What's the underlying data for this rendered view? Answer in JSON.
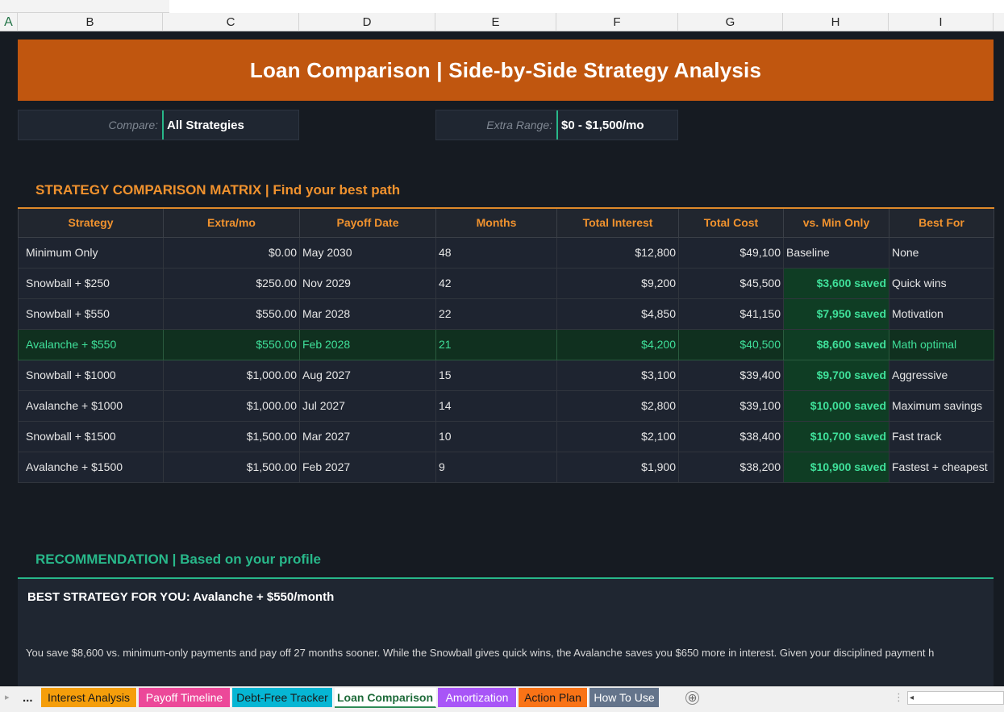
{
  "columns": [
    "A",
    "B",
    "C",
    "D",
    "E",
    "F",
    "G",
    "H",
    "I"
  ],
  "title": "Loan Comparison  |  Side-by-Side Strategy Analysis",
  "filters": {
    "compare_label": "Compare:",
    "compare_value": "All Strategies",
    "range_label": "Extra Range:",
    "range_value": "$0 - $1,500/mo"
  },
  "matrix": {
    "title": "STRATEGY COMPARISON MATRIX  |  Find your best path",
    "headers": [
      "Strategy",
      "Extra/mo",
      "Payoff Date",
      "Months",
      "Total Interest",
      "Total Cost",
      "vs. Min Only",
      "Best For"
    ],
    "rows": [
      [
        "Minimum Only",
        "$0.00",
        "May 2030",
        "48",
        "$12,800",
        "$49,100",
        "Baseline",
        "None"
      ],
      [
        "Snowball + $250",
        "$250.00",
        "Nov 2029",
        "42",
        "$9,200",
        "$45,500",
        "$3,600 saved",
        "Quick wins"
      ],
      [
        "Snowball + $550",
        "$550.00",
        "Mar 2028",
        "22",
        "$4,850",
        "$41,150",
        "$7,950 saved",
        "Motivation"
      ],
      [
        "Avalanche + $550",
        "$550.00",
        "Feb 2028",
        "21",
        "$4,200",
        "$40,500",
        "$8,600 saved",
        "Math optimal"
      ],
      [
        "Snowball + $1000",
        "$1,000.00",
        "Aug 2027",
        "15",
        "$3,100",
        "$39,400",
        "$9,700 saved",
        "Aggressive"
      ],
      [
        "Avalanche + $1000",
        "$1,000.00",
        "Jul 2027",
        "14",
        "$2,800",
        "$39,100",
        "$10,000 saved",
        "Maximum savings"
      ],
      [
        "Snowball + $1500",
        "$1,500.00",
        "Mar 2027",
        "10",
        "$2,100",
        "$38,400",
        "$10,700 saved",
        "Fast track"
      ],
      [
        "Avalanche + $1500",
        "$1,500.00",
        "Feb 2027",
        "9",
        "$1,900",
        "$38,200",
        "$10,900 saved",
        "Fastest + cheapest"
      ]
    ],
    "highlight_row": 3
  },
  "recommendation": {
    "title": "RECOMMENDATION  |  Based on your profile",
    "heading": "BEST STRATEGY FOR YOU: Avalanche + $550/month",
    "body": "You save $8,600 vs. minimum-only payments and pay off 27 months sooner. While the Snowball gives quick wins, the Avalanche saves you $650 more in interest. Given your disciplined payment h"
  },
  "tabs": {
    "ellipsis": "...",
    "items": [
      {
        "label": "Interest Analysis",
        "color": "#f59e0b"
      },
      {
        "label": "Payoff Timeline",
        "color": "#ec4899"
      },
      {
        "label": "Debt-Free Tracker",
        "color": "#06b6d4"
      },
      {
        "label": "Loan Comparison",
        "color": "#ffffff",
        "active": true
      },
      {
        "label": "Amortization",
        "color": "#a855f7"
      },
      {
        "label": "Action Plan",
        "color": "#f97316"
      },
      {
        "label": "How To Use",
        "color": "#64748b"
      }
    ],
    "add_icon": "⊕"
  },
  "colors": {
    "title_bg": "#c0560f",
    "accent_orange": "#f0922e",
    "accent_green": "#28b88a",
    "saved_green": "#3fe09a",
    "sheet_bg": "#161b22"
  }
}
